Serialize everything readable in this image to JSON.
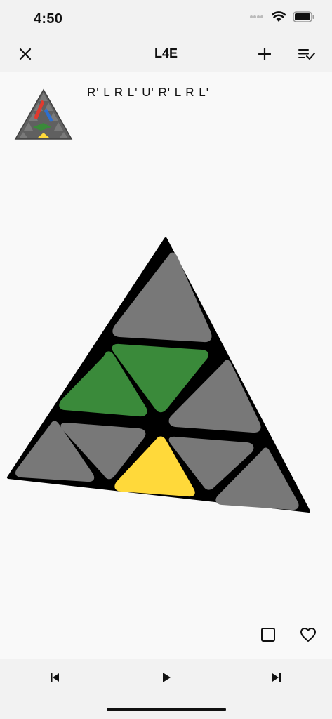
{
  "status_bar": {
    "time": "4:50"
  },
  "navigation": {
    "title": "L4E"
  },
  "case": {
    "algorithm": "R' L R L' U' R' L R L'"
  },
  "colors": {
    "green": "#3a8a3a",
    "yellow": "#ffd93a",
    "gray": "#787878",
    "red": "#e03a2e",
    "blue": "#2e6fd0"
  }
}
